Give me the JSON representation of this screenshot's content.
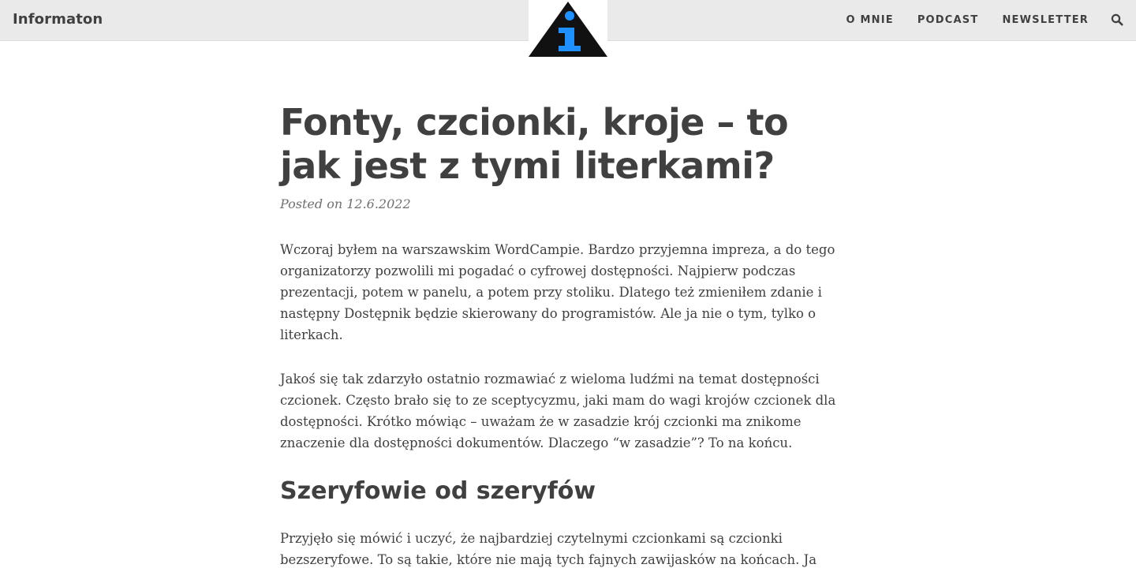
{
  "site": {
    "title": "Informaton"
  },
  "nav": {
    "items": [
      {
        "label": "O MNIE"
      },
      {
        "label": "PODCAST"
      },
      {
        "label": "NEWSLETTER"
      }
    ],
    "search_icon": "search-icon"
  },
  "logo": {
    "icon": "information-triangle-logo",
    "colors": {
      "triangle": "#111111",
      "glyph": "#1e90ff"
    }
  },
  "post": {
    "title": "Fonty, czcionki, kroje – to jak jest z tymi literkami?",
    "meta_prefix": "Posted on",
    "date": "12.6.2022",
    "paragraph_1": "Wczoraj byłem na warszawskim WordCampie. Bardzo przyjemna impreza, a do tego organizatorzy pozwolili mi pogadać o cyfrowej dostępności. Najpierw podczas prezentacji, potem w panelu, a potem przy stoliku. Dlatego też zmieniłem zdanie i następny Dostępnik będzie skierowany do programistów. Ale ja nie o tym, tylko o literkach.",
    "paragraph_2": "Jakoś się tak zdarzyło ostatnio rozmawiać z wieloma ludźmi na temat dostępności czcionek. Często brało się to ze sceptycyzmu, jaki mam do wagi krojów czcionek dla dostępności. Krótko mówiąc – uważam że w zasadzie krój czcionki ma znikome znaczenie dla dostępności dokumentów. Dlaczego “w zasadzie”? To na końcu.",
    "heading_1": "Szeryfowie od szeryfów",
    "paragraph_3": "Przyjęło się mówić i uczyć, że najbardziej czytelnymi czcionkami są czcionki bezszeryfowe. To są takie, które nie mają tych fajnych zawijasków na końcach. Ja też"
  }
}
